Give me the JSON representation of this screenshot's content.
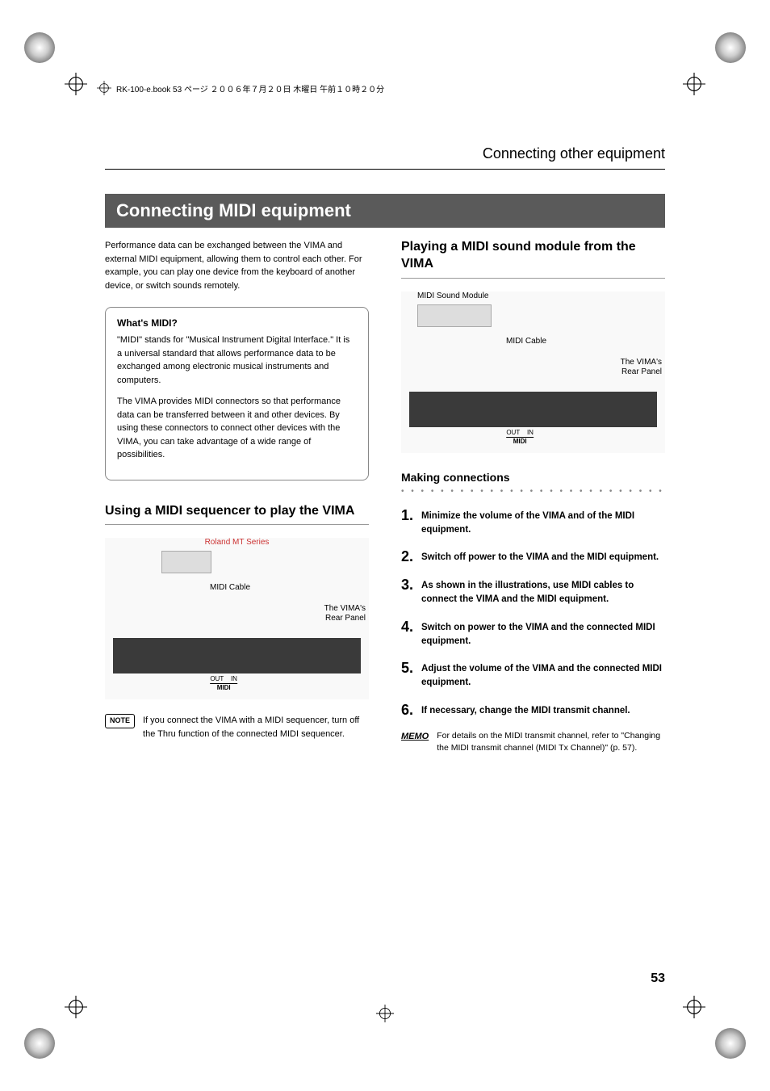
{
  "header": {
    "bookline": "RK-100-e.book 53 ページ ２００６年７月２０日 木曜日 午前１０時２０分"
  },
  "chapter_title": "Connecting other equipment",
  "section_title": "Connecting MIDI equipment",
  "intro": "Performance data can be exchanged between the VIMA and external MIDI equipment, allowing them to control each other. For example, you can play one device from the keyboard of another device, or switch sounds remotely.",
  "whats_midi": {
    "title": "What's MIDI?",
    "p1": "\"MIDI\" stands for \"Musical Instrument Digital Interface.\" It is a universal standard that allows performance data to be exchanged among electronic musical instruments and computers.",
    "p2": "The VIMA provides MIDI connectors so that performance data can be transferred between it and other devices. By using these connectors to connect other devices with the VIMA, you can take advantage of a wide range of possibilities."
  },
  "left_sub": "Using a MIDI sequencer to play the VIMA",
  "diagram_left": {
    "top_label": "Roland MT Series",
    "cable_label": "MIDI Cable",
    "panel_label1": "The VIMA's",
    "panel_label2": "Rear Panel",
    "ports": "OUT    IN",
    "midi": "MIDI"
  },
  "note_tag": "NOTE",
  "note_text": "If you connect the VIMA with a MIDI sequencer, turn off the Thru function of the connected MIDI sequencer.",
  "right_sub": "Playing a MIDI sound module from the VIMA",
  "diagram_right": {
    "top_label": "MIDI Sound Module",
    "cable_label": "MIDI Cable",
    "panel_label1": "The VIMA's",
    "panel_label2": "Rear Panel",
    "ports": "OUT    IN",
    "midi": "MIDI"
  },
  "making_connections": {
    "title": "Making connections",
    "steps": [
      "Minimize the volume of the VIMA and of the MIDI equipment.",
      "Switch off power to the VIMA and the MIDI equipment.",
      "As shown in the illustrations, use MIDI cables to connect the VIMA and the MIDI equipment.",
      "Switch on power to the VIMA and the connected MIDI equipment.",
      "Adjust the volume of the VIMA and the connected MIDI equipment.",
      "If necessary, change the MIDI transmit channel."
    ]
  },
  "memo_tag": "MEMO",
  "memo_text": "For details on the MIDI transmit channel, refer to \"Changing the MIDI transmit channel (MIDI Tx Channel)\" (p. 57).",
  "page_number": "53"
}
